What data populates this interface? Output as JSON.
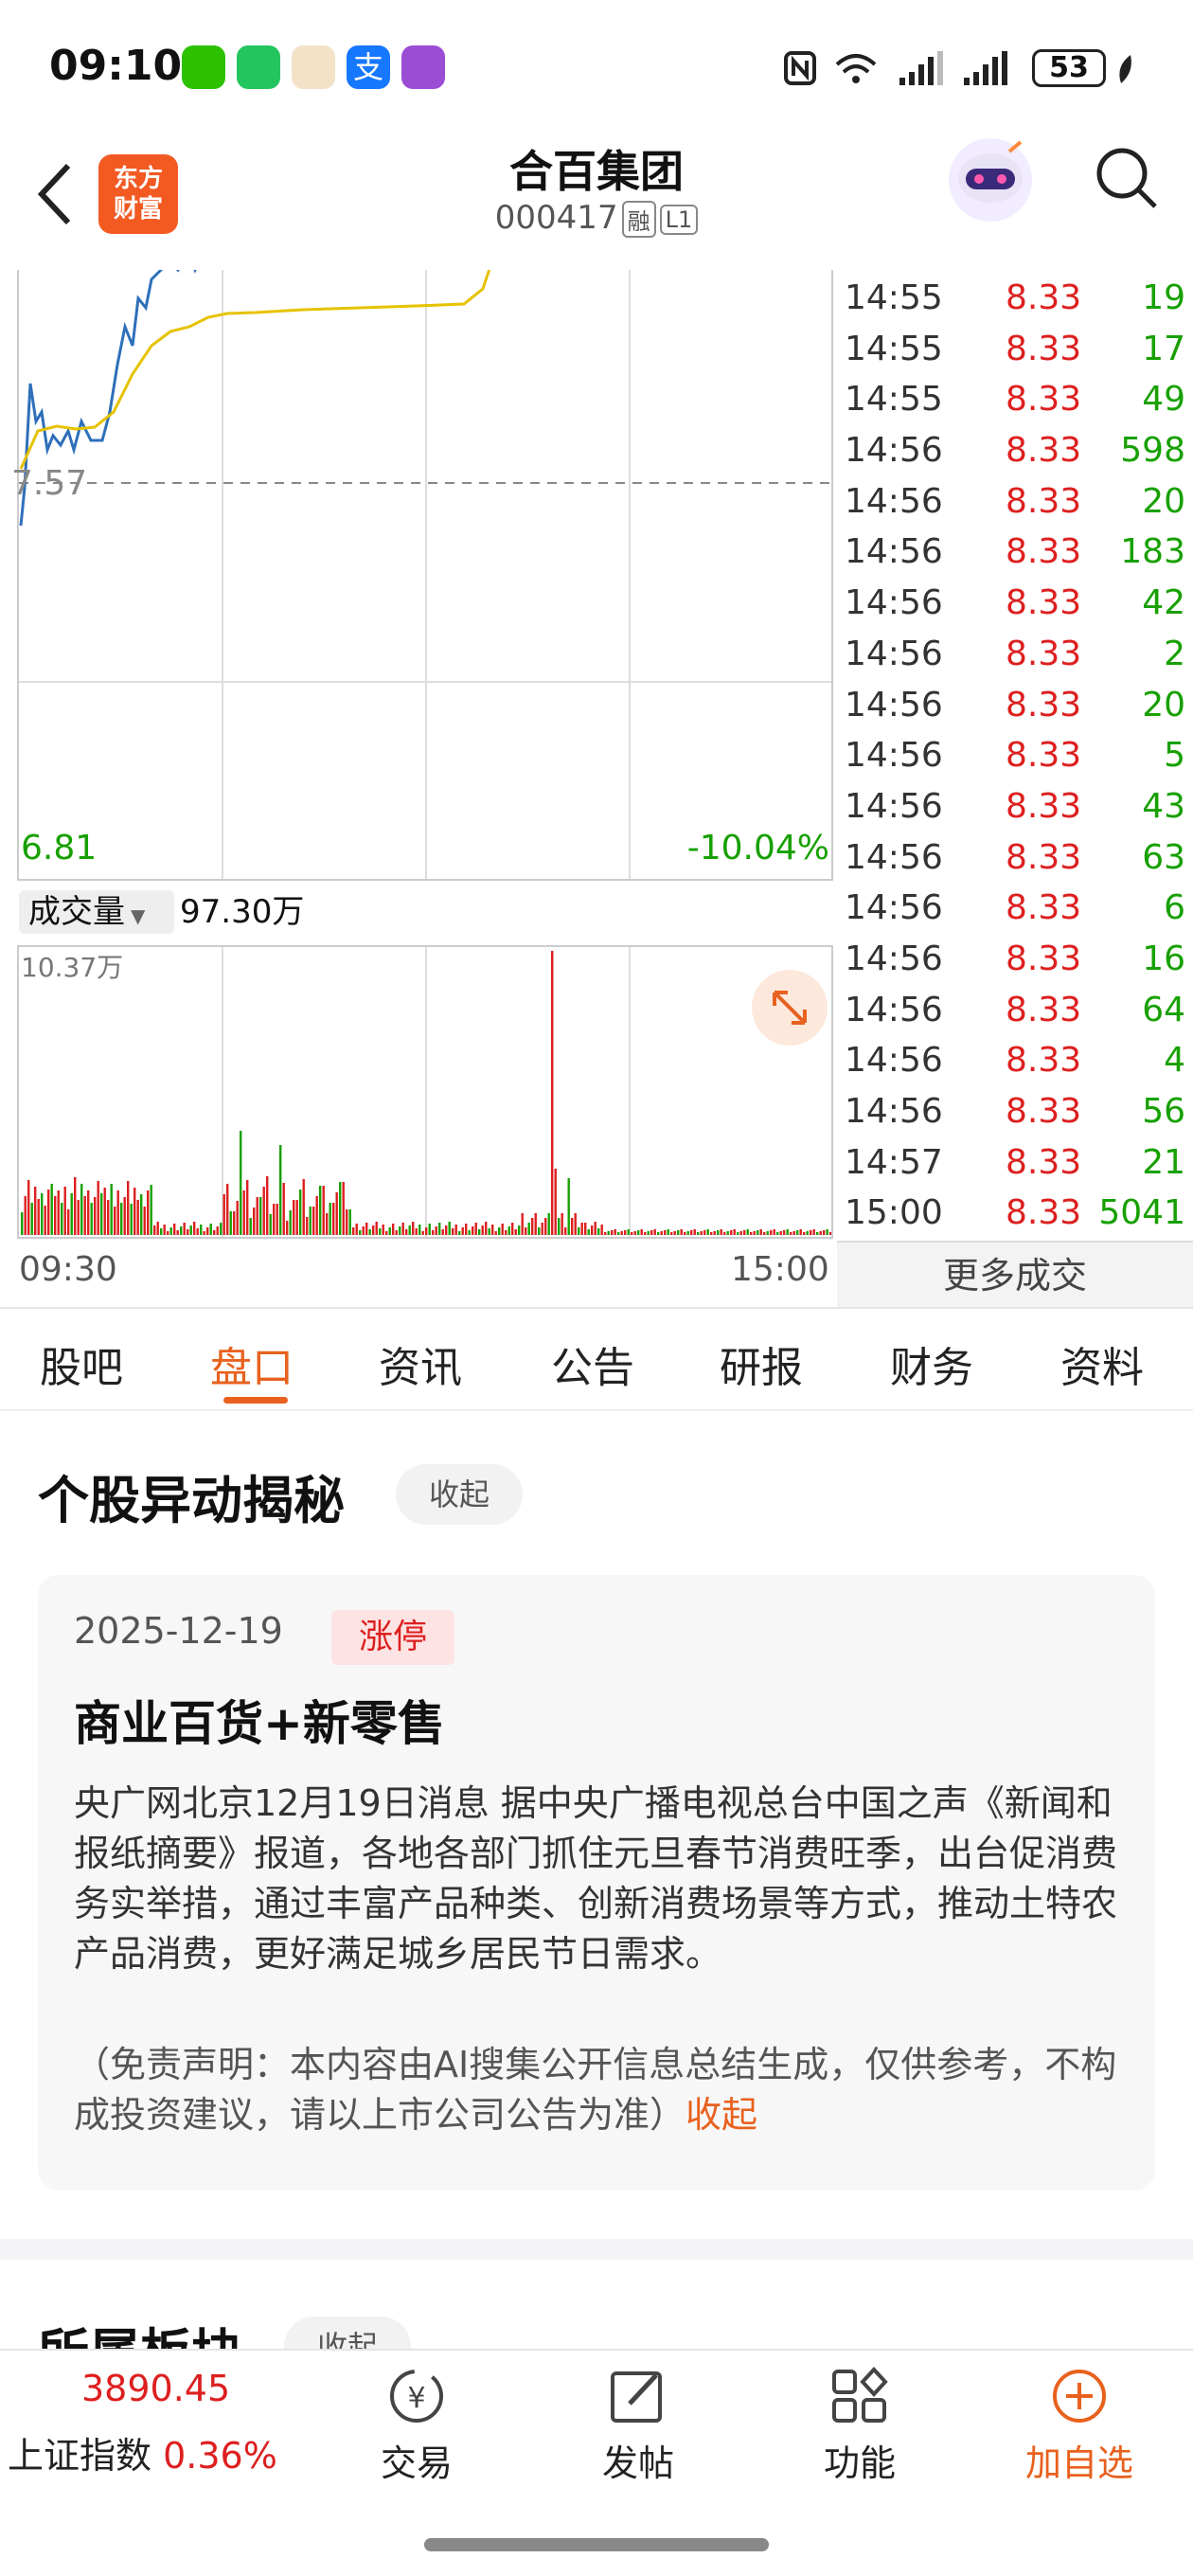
{
  "status_bar": {
    "time": "09:10",
    "battery": "53"
  },
  "header": {
    "logo_text": "东方\n财富",
    "stock_name": "合百集团",
    "stock_code": "000417",
    "tags": [
      "融",
      "L1"
    ]
  },
  "chart": {
    "price_ref": "7.57",
    "price_low": "6.81",
    "pct_low": "-10.04%",
    "volume_selector": "成交量",
    "volume_total": "97.30万",
    "volume_max": "10.37万",
    "time_start": "09:30",
    "time_end": "15:00"
  },
  "trades": [
    {
      "time": "14:55",
      "price": "8.33",
      "vol": "19"
    },
    {
      "time": "14:55",
      "price": "8.33",
      "vol": "17"
    },
    {
      "time": "14:55",
      "price": "8.33",
      "vol": "49"
    },
    {
      "time": "14:56",
      "price": "8.33",
      "vol": "598"
    },
    {
      "time": "14:56",
      "price": "8.33",
      "vol": "20"
    },
    {
      "time": "14:56",
      "price": "8.33",
      "vol": "183"
    },
    {
      "time": "14:56",
      "price": "8.33",
      "vol": "42"
    },
    {
      "time": "14:56",
      "price": "8.33",
      "vol": "2"
    },
    {
      "time": "14:56",
      "price": "8.33",
      "vol": "20"
    },
    {
      "time": "14:56",
      "price": "8.33",
      "vol": "5"
    },
    {
      "time": "14:56",
      "price": "8.33",
      "vol": "43"
    },
    {
      "time": "14:56",
      "price": "8.33",
      "vol": "63"
    },
    {
      "time": "14:56",
      "price": "8.33",
      "vol": "6"
    },
    {
      "time": "14:56",
      "price": "8.33",
      "vol": "16"
    },
    {
      "time": "14:56",
      "price": "8.33",
      "vol": "64"
    },
    {
      "time": "14:56",
      "price": "8.33",
      "vol": "4"
    },
    {
      "time": "14:56",
      "price": "8.33",
      "vol": "56"
    },
    {
      "time": "14:57",
      "price": "8.33",
      "vol": "21"
    },
    {
      "time": "15:00",
      "price": "8.33",
      "vol": "5041"
    }
  ],
  "more_trades": "更多成交",
  "tabs": [
    "股吧",
    "盘口",
    "资讯",
    "公告",
    "研报",
    "财务",
    "资料"
  ],
  "active_tab": "盘口",
  "anomaly": {
    "title": "个股异动揭秘",
    "collapse": "收起",
    "date": "2025-12-19",
    "badge": "涨停",
    "headline": "商业百货+新零售",
    "body": "央广网北京12月19日消息 据中央广播电视总台中国之声《新闻和报纸摘要》报道，各地各部门抓住元旦春节消费旺季，出台促消费务实举措，通过丰富产品种类、创新消费场景等方式，推动土特农产品消费，更好满足城乡居民节日需求。",
    "disclaimer": "（免责声明：本内容由AI搜集公开信息总结生成，仅供参考，不构成投资建议，请以上市公司公告为准）",
    "disclaimer_link": "收起"
  },
  "sector": {
    "title": "所属板块",
    "collapse": "收起"
  },
  "bottom": {
    "index_value": "3890.45",
    "index_name": "上证指数",
    "index_pct": "0.36%",
    "nav": [
      "交易",
      "发帖",
      "功能",
      "加自选"
    ]
  },
  "colors": {
    "up": "#dd1f1f",
    "down": "#17a000",
    "accent": "#e8611e",
    "price_line": "#2e6fba",
    "avg_line": "#e6c200"
  }
}
